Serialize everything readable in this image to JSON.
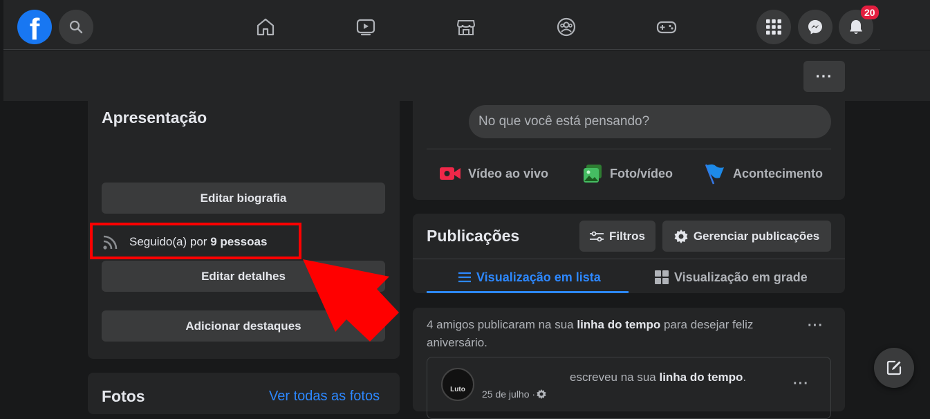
{
  "header": {
    "logo_letter": "f",
    "notification_count": "20",
    "more_label": "···"
  },
  "intro": {
    "title": "Apresentação",
    "edit_bio_label": "Editar biografia",
    "followed_prefix": "Seguido(a) por ",
    "followed_count": "9 pessoas",
    "edit_details_label": "Editar detalhes",
    "add_highlights_label": "Adicionar destaques"
  },
  "photos": {
    "title": "Fotos",
    "see_all_label": "Ver todas as fotos"
  },
  "composer": {
    "placeholder": "No que você está pensando?",
    "live_video_label": "Vídeo ao vivo",
    "photo_video_label": "Foto/vídeo",
    "event_label": "Acontecimento"
  },
  "posts": {
    "title": "Publicações",
    "filters_label": "Filtros",
    "manage_label": "Gerenciar publicações",
    "tab_list_label": "Visualização em lista",
    "tab_grid_label": "Visualização em grade"
  },
  "feed": {
    "summary_part1": "4 amigos publicaram na sua ",
    "summary_bold": "linha do tempo",
    "summary_part2": " para desejar feliz aniversário.",
    "options_label": "···",
    "post_action": "escreveu na sua ",
    "post_action_bold": "linha do tempo",
    "post_action_end": ".",
    "post_date": "25 de julho · ",
    "avatar_text": "Luto",
    "post_options_label": "···"
  },
  "colors": {
    "accent": "#2d88ff",
    "brand": "#1877f2",
    "highlight": "#ff0000",
    "badge": "#e41e3f"
  },
  "icons": [
    "search-icon",
    "home-icon",
    "watch-icon",
    "marketplace-icon",
    "groups-icon",
    "gaming-icon",
    "menu-grid-icon",
    "messenger-icon",
    "bell-icon",
    "rss-icon",
    "live-video-icon",
    "photo-icon",
    "flag-icon",
    "filter-icon",
    "gear-icon",
    "list-icon",
    "grid-icon",
    "compose-icon"
  ]
}
